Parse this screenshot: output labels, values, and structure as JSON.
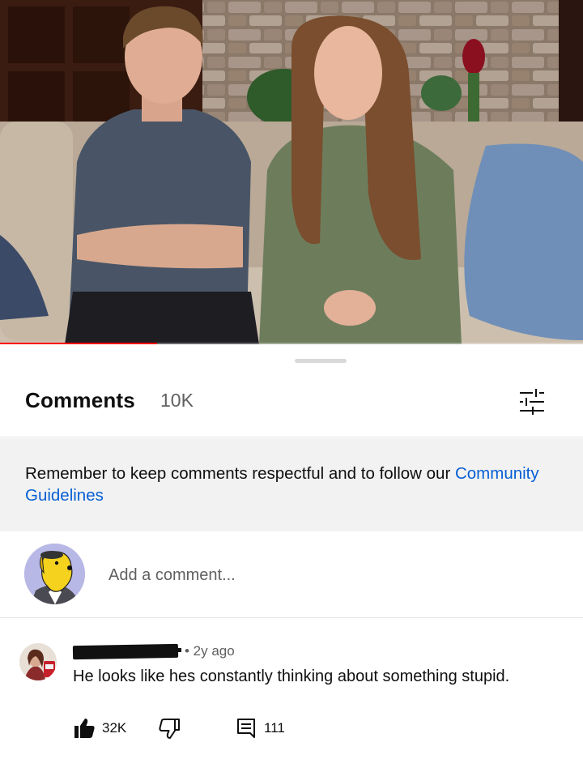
{
  "video": {
    "progress_fraction": 0.27
  },
  "comments_panel": {
    "title": "Comments",
    "count": "10K",
    "filter_icon": "sliders-icon",
    "notice": {
      "text": "Remember to keep comments respectful and to follow our ",
      "link": "Community Guidelines"
    },
    "add_comment": {
      "placeholder": "Add a comment...",
      "avatar_icon": "dog-cartoon-avatar"
    },
    "comments": [
      {
        "time": "• 2y ago",
        "text": "He looks like hes constantly thinking about something stupid.",
        "likes": "32K",
        "replies": "111",
        "like_icon": "thumbs-up-filled-icon",
        "dislike_icon": "thumbs-down-icon",
        "reply_icon": "reply-comment-icon"
      }
    ]
  },
  "colors": {
    "link": "#065fd4",
    "progress": "#ff0000",
    "secondary_text": "#606060",
    "notice_bg": "#f2f2f2"
  }
}
